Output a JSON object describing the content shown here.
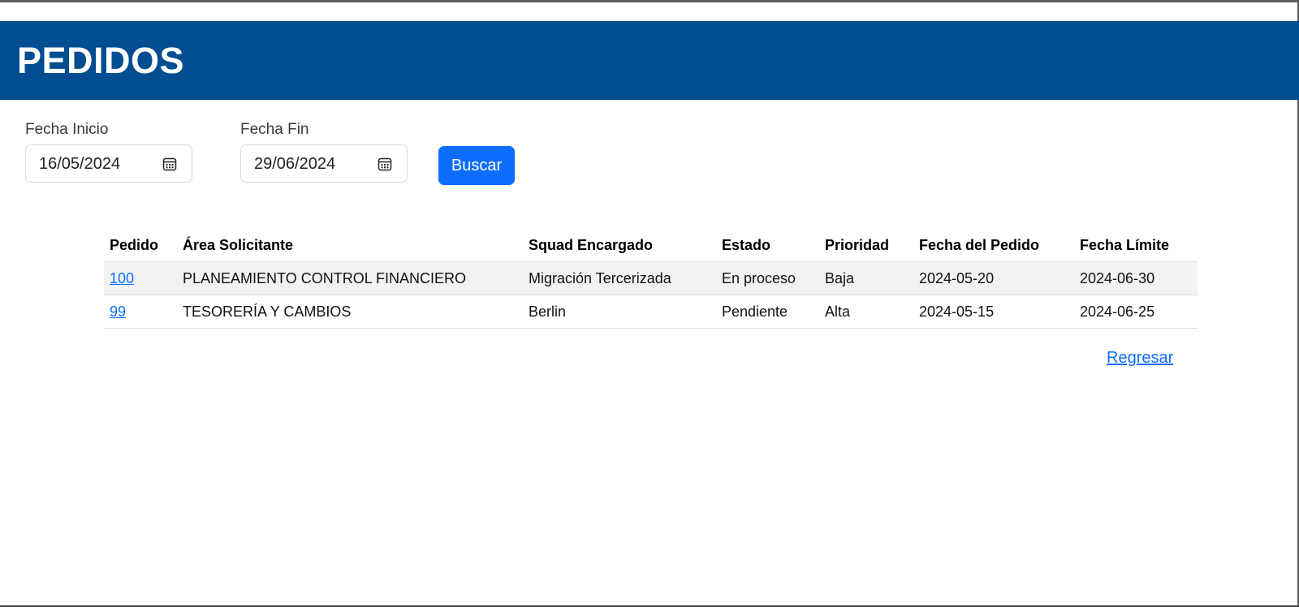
{
  "header": {
    "title": "PEDIDOS"
  },
  "filters": {
    "start": {
      "label": "Fecha Inicio",
      "value": "16/05/2024",
      "icon": "calendar-icon"
    },
    "end": {
      "label": "Fecha Fin",
      "value": "29/06/2024",
      "icon": "calendar-icon"
    },
    "search_label": "Buscar"
  },
  "table": {
    "headers": [
      "Pedido",
      "Área Solicitante",
      "Squad Encargado",
      "Estado",
      "Prioridad",
      "Fecha del Pedido",
      "Fecha Límite"
    ],
    "rows": [
      {
        "pedido": "100",
        "area": "PLANEAMIENTO CONTROL FINANCIERO",
        "squad": "Migración Tercerizada",
        "estado": "En proceso",
        "prioridad": "Baja",
        "fecha_pedido": "2024-05-20",
        "fecha_limite": "2024-06-30"
      },
      {
        "pedido": "99",
        "area": "TESORERÍA Y CAMBIOS",
        "squad": "Berlin",
        "estado": "Pendiente",
        "prioridad": "Alta",
        "fecha_pedido": "2024-05-15",
        "fecha_limite": "2024-06-25"
      }
    ]
  },
  "back_link": "Regresar",
  "colors": {
    "header_bg": "#004d91",
    "primary": "#0d6efd",
    "row_shade": "#f2f2f2"
  }
}
